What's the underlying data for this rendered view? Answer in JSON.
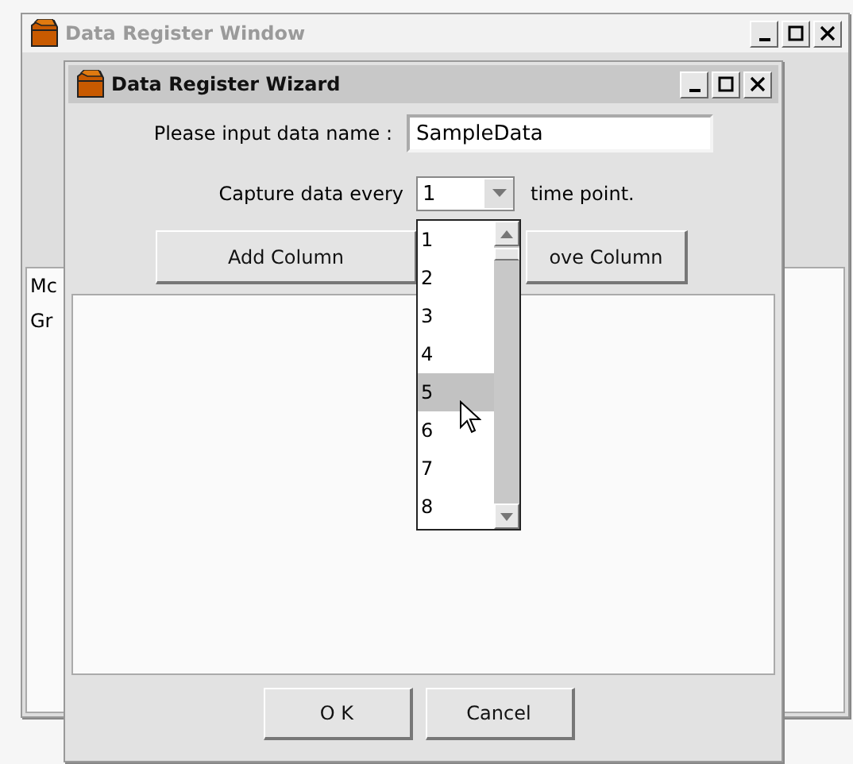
{
  "background_window": {
    "title": "Data Register Window",
    "active": false,
    "list_items": [
      "Mc",
      "Gr"
    ]
  },
  "wizard": {
    "title": "Data Register Wizard",
    "active": true,
    "name_label": "Please input data name :",
    "name_value": "SampleData",
    "capture_label": "Capture data every",
    "capture_value": "1",
    "capture_suffix": "time point.",
    "column_buttons": [
      "Add Column",
      "ove Column"
    ],
    "dialog_buttons": [
      "O K",
      "Cancel"
    ]
  },
  "dropdown": {
    "options": [
      {
        "label": "1",
        "selected": false
      },
      {
        "label": "2",
        "selected": false
      },
      {
        "label": "3",
        "selected": false
      },
      {
        "label": "4",
        "selected": false
      },
      {
        "label": "5",
        "selected": true
      },
      {
        "label": "6",
        "selected": false
      },
      {
        "label": "7",
        "selected": false
      },
      {
        "label": "8",
        "selected": false
      }
    ]
  }
}
